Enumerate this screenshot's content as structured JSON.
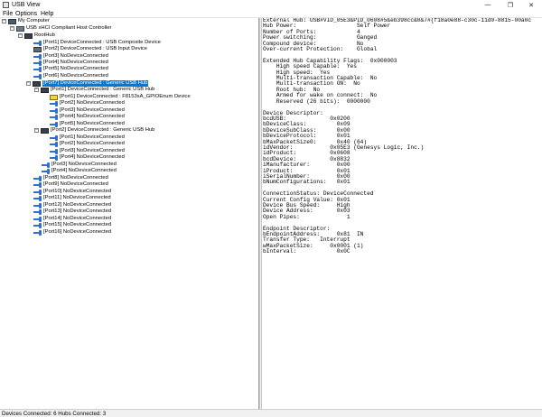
{
  "window": {
    "title": "USB View"
  },
  "menu": [
    "File",
    "Options",
    "Help"
  ],
  "tree": [
    {
      "label": "My Computer",
      "icon": "computer-icon",
      "expander": "-"
    },
    {
      "label": "USB xHCI Compliant Host Controller",
      "icon": "controller-icon",
      "expander": "-"
    },
    {
      "label": "RootHub",
      "icon": "hub-icon",
      "expander": "-"
    },
    {
      "label": "[Port1] DeviceConnected :  USB Composite Device",
      "icon": "usb-icon"
    },
    {
      "label": "[Port2] DeviceConnected :  USB Input Device",
      "icon": "device-icon"
    },
    {
      "label": "[Port3] NoDeviceConnected",
      "icon": "usb-icon"
    },
    {
      "label": "[Port4] NoDeviceConnected",
      "icon": "usb-icon"
    },
    {
      "label": "[Port5] NoDeviceConnected",
      "icon": "usb-icon"
    },
    {
      "label": "[Port6] NoDeviceConnected",
      "icon": "usb-icon"
    },
    {
      "label": "[Port7] DeviceConnected :  Generic USB Hub",
      "icon": "hub-icon",
      "expander": "-",
      "selected": true
    },
    {
      "label": "[Port1] DeviceConnected :  Generic USB Hub",
      "icon": "hub-icon",
      "expander": "-"
    },
    {
      "label": "[Port1] DeviceConnected :  F8153xA_GPIOEnum Device",
      "icon": "warning-device-icon"
    },
    {
      "label": "[Port2] NoDeviceConnected",
      "icon": "usb-icon"
    },
    {
      "label": "[Port3] NoDeviceConnected",
      "icon": "usb-icon"
    },
    {
      "label": "[Port4] NoDeviceConnected",
      "icon": "usb-icon"
    },
    {
      "label": "[Port5] NoDeviceConnected",
      "icon": "usb-icon"
    },
    {
      "label": "[Port2] DeviceConnected :  Generic USB Hub",
      "icon": "hub-icon",
      "expander": "-"
    },
    {
      "label": "[Port1] NoDeviceConnected",
      "icon": "usb-icon"
    },
    {
      "label": "[Port2] NoDeviceConnected",
      "icon": "usb-icon"
    },
    {
      "label": "[Port3] NoDeviceConnected",
      "icon": "usb-icon"
    },
    {
      "label": "[Port4] NoDeviceConnected",
      "icon": "usb-icon"
    },
    {
      "label": "[Port3] NoDeviceConnected",
      "icon": "usb-icon"
    },
    {
      "label": "[Port4] NoDeviceConnected",
      "icon": "usb-icon"
    },
    {
      "label": "[Port8] NoDeviceConnected",
      "icon": "usb-icon"
    },
    {
      "label": "[Port9] NoDeviceConnected",
      "icon": "usb-icon"
    },
    {
      "label": "[Port10] NoDeviceConnected",
      "icon": "usb-icon"
    },
    {
      "label": "[Port11] NoDeviceConnected",
      "icon": "usb-icon"
    },
    {
      "label": "[Port12] NoDeviceConnected",
      "icon": "usb-icon"
    },
    {
      "label": "[Port13] NoDeviceConnected",
      "icon": "usb-icon"
    },
    {
      "label": "[Port14] NoDeviceConnected",
      "icon": "usb-icon"
    },
    {
      "label": "[Port15] NoDeviceConnected",
      "icon": "usb-icon"
    },
    {
      "label": "[Port16] NoDeviceConnected",
      "icon": "usb-icon"
    }
  ],
  "details": "External Hub: USB#VID_05E3&PID_0608#5&eb398cc&0&7#{f18a0e88-c30c-11d0-8815-00a0c\nHub Power:                  Self Power\nNumber of Ports:            4\nPower switching:            Ganged\nCompound device:            No\nOver-current Protection:    Global\n\nExtended Hub Capability Flags:  0x000003\n    High speed Capable:  Yes\n    High speed:  Yes\n    Multi-transaction Capable:  No\n    Multi-transaction ON:  No\n    Root hub:  No\n    Armed for wake on connect:  No\n    Reserved (26 bits):  0000000\n\nDevice Descriptor:\nbcdUSB:             0x0200\nbDeviceClass:         0x09\nbDeviceSubClass:      0x00\nbDeviceProtocol:      0x01\nbMaxPacketSize0:      0x40 (64)\nidVendor:           0x05E3 (Genesys Logic, Inc.)\nidProduct:          0x0608\nbcdDevice:          0x8832\niManufacturer:        0x00\niProduct:             0x01\niSerialNumber:        0x00\nbNumConfigurations:   0x01\n\nConnectionStatus: DeviceConnected\nCurrent Config Value: 0x01\nDevice Bus Speed:     High\nDevice Address:       0x03\nOpen Pipes:              1\n\nEndpoint Descriptor:\nbEndpointAddress:     0x81  IN\nTransfer Type:   Interrupt\nwMaxPacketSize:     0x0001 (1)\nbInterval:            0x0C",
  "status": "Devices Connected: 6   Hubs Connected: 3"
}
